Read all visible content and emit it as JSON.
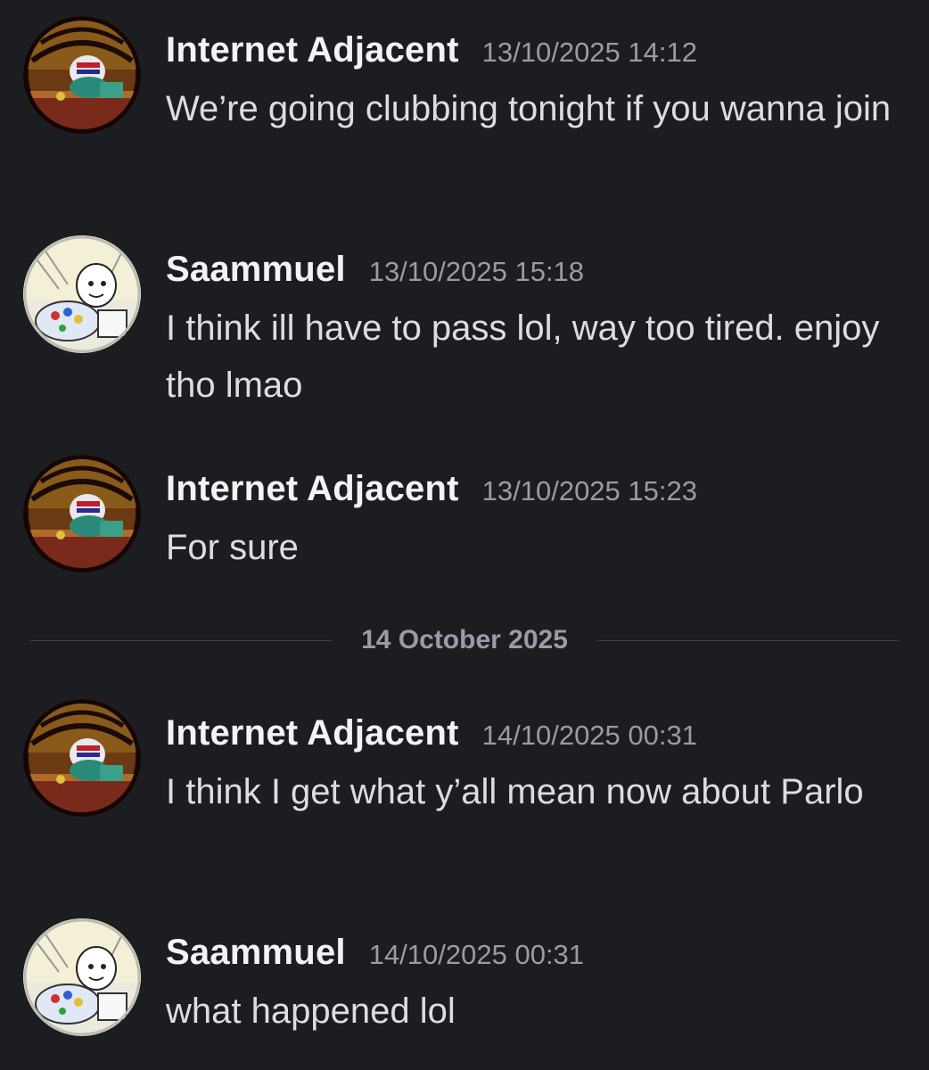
{
  "users": {
    "internet_adjacent": "Internet Adjacent",
    "saammuel": "Saammuel"
  },
  "messages": [
    {
      "author": "Internet Adjacent",
      "timestamp": "13/10/2025 14:12",
      "text": "We’re going clubbing tonight if you wanna join"
    },
    {
      "author": "Saammuel",
      "timestamp": "13/10/2025 15:18",
      "text": "I think ill have to pass lol, way too tired. enjoy tho lmao"
    },
    {
      "author": "Internet Adjacent",
      "timestamp": "13/10/2025 15:23",
      "text": "For sure"
    },
    {
      "author": "Internet Adjacent",
      "timestamp": "14/10/2025 00:31",
      "text": "I think I get what y’all mean now about Parlo"
    },
    {
      "author": "Saammuel",
      "timestamp": "14/10/2025 00:31",
      "text": "what happened lol"
    }
  ],
  "date_divider": {
    "label": "14 October 2025"
  },
  "icons": {
    "avatar_internet_adjacent": "courtroom-anime-avatar",
    "avatar_saammuel": "sketch-cartoon-avatar"
  },
  "colors": {
    "background": "#1c1d21",
    "username": "#f2f3f5",
    "timestamp": "#9a9ca5",
    "message_text": "#dbdee1",
    "divider_line": "#3f4147"
  }
}
